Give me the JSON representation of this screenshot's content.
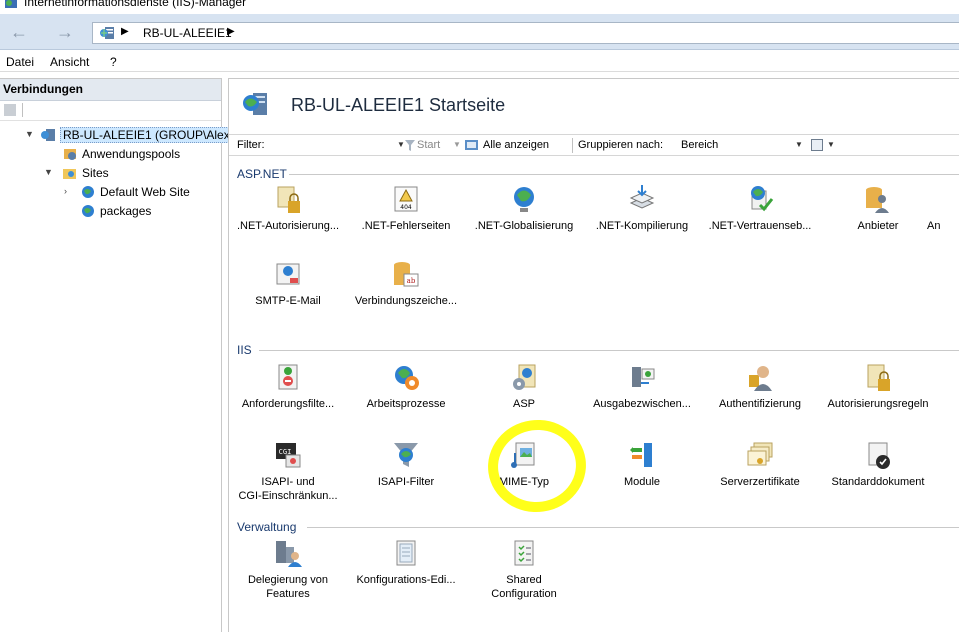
{
  "window": {
    "title": "Internetinformationsdienste (IIS)-Manager"
  },
  "addressbar": {
    "back": "←",
    "forward": "→",
    "crumb": "RB-UL-ALEEIE1",
    "separator": "▶"
  },
  "menu": [
    "Datei",
    "Ansicht",
    "?"
  ],
  "connections": {
    "header": "Verbindungen",
    "tree": [
      {
        "label": "RB-UL-ALEEIE1 (GROUP\\Alexa",
        "icon": "server-icon"
      },
      {
        "label": "Anwendungspools",
        "icon": "app-pool-icon"
      },
      {
        "label": "Sites",
        "icon": "sites-folder-icon"
      },
      {
        "label": "Default Web Site",
        "icon": "globe-icon"
      },
      {
        "label": "packages",
        "icon": "globe-icon"
      }
    ]
  },
  "main": {
    "title": "RB-UL-ALEEIE1 Startseite",
    "filter": {
      "label": "Filter:",
      "value": "",
      "start": "Start",
      "show_all": "Alle anzeigen",
      "group_label": "Gruppieren nach:",
      "group_value": "Bereich"
    },
    "groups": [
      {
        "name": "ASP.NET",
        "items": [
          {
            "label": ".NET-Autorisierung...",
            "icon": "lock-document-icon"
          },
          {
            "label": ".NET-Fehlerseiten",
            "icon": "error-404-icon"
          },
          {
            "label": ".NET-Globalisierung",
            "icon": "globe-icon"
          },
          {
            "label": ".NET-Kompilierung",
            "icon": "compile-layers-icon"
          },
          {
            "label": ".NET-Vertrauenseb...",
            "icon": "trust-check-icon"
          },
          {
            "label": "Anbieter",
            "icon": "provider-database-icon"
          },
          {
            "label": "An",
            "icon": "partial-icon"
          },
          {
            "label": "SMTP-E-Mail",
            "icon": "email-icon"
          },
          {
            "label": "Verbindungszeiche...",
            "icon": "connection-string-icon"
          }
        ]
      },
      {
        "name": "IIS",
        "items": [
          {
            "label": "Anforderungsfilte...",
            "icon": "request-filter-icon"
          },
          {
            "label": "Arbeitsprozesse",
            "icon": "worker-process-icon"
          },
          {
            "label": "ASP",
            "icon": "asp-gear-icon"
          },
          {
            "label": "Ausgabezwischen...",
            "icon": "output-cache-icon"
          },
          {
            "label": "Authentifizierung",
            "icon": "authentication-user-icon"
          },
          {
            "label": "Autorisierungsregeln",
            "icon": "authorization-lock-icon"
          },
          {
            "label": "ISAPI- und",
            "label2": "CGI-Einschränkun...",
            "icon": "cgi-icon"
          },
          {
            "label": "ISAPI-Filter",
            "icon": "funnel-globe-icon"
          },
          {
            "label": "MIME-Typ",
            "icon": "mime-type-icon"
          },
          {
            "label": "Module",
            "icon": "modules-icon"
          },
          {
            "label": "Serverzertifikate",
            "icon": "certificate-icon"
          },
          {
            "label": "Standarddokument",
            "icon": "default-document-icon"
          }
        ]
      },
      {
        "name": "Verwaltung",
        "items": [
          {
            "label": "Delegierung von",
            "label2": "Features",
            "icon": "delegation-icon"
          },
          {
            "label": "Konfigurations-Edi...",
            "icon": "config-editor-icon"
          },
          {
            "label": "Shared",
            "label2": "Configuration",
            "icon": "shared-config-icon"
          }
        ]
      }
    ]
  },
  "colors": {
    "accent": "#1a3a6e",
    "highlight": "#ffff1a",
    "address_bg": "#d7e3f1"
  }
}
